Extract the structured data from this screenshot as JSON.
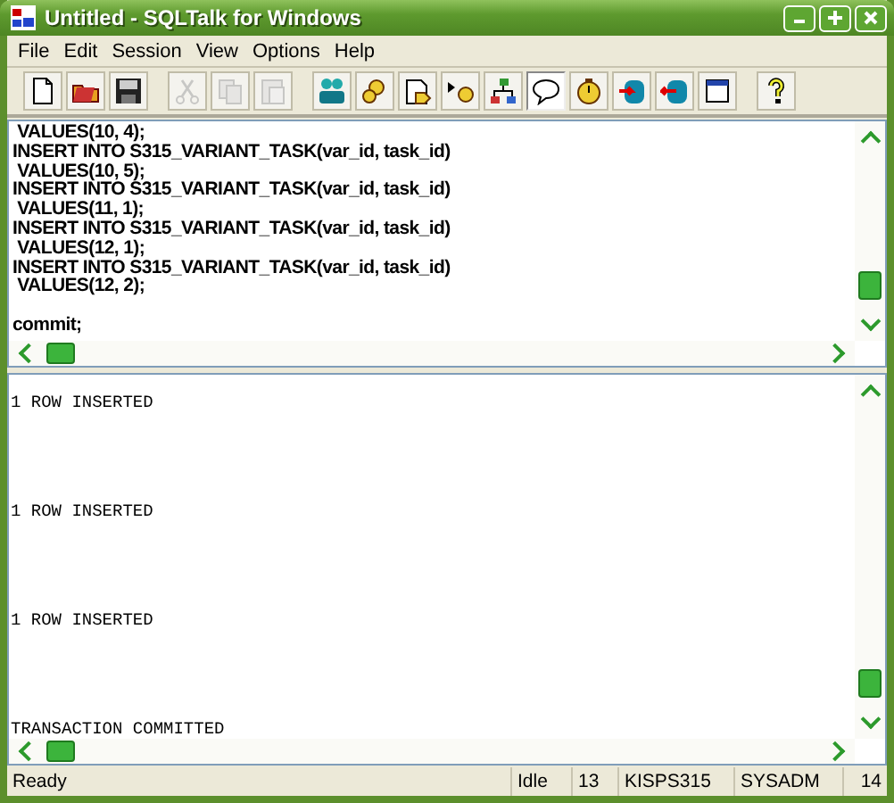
{
  "window": {
    "title": "Untitled - SQLTalk for Windows"
  },
  "menu": [
    {
      "label": "File"
    },
    {
      "label": "Edit"
    },
    {
      "label": "Session"
    },
    {
      "label": "View"
    },
    {
      "label": "Options"
    },
    {
      "label": "Help"
    }
  ],
  "toolbar": [
    {
      "buttons": [
        {
          "kind": "new",
          "disabled": false,
          "pressed": false
        },
        {
          "kind": "open",
          "disabled": false,
          "pressed": false
        },
        {
          "kind": "save",
          "disabled": false,
          "pressed": false
        }
      ]
    },
    {
      "buttons": [
        {
          "kind": "cut",
          "disabled": true,
          "pressed": false
        },
        {
          "kind": "copy",
          "disabled": true,
          "pressed": false
        },
        {
          "kind": "paste",
          "disabled": true,
          "pressed": false
        }
      ]
    },
    {
      "buttons": [
        {
          "kind": "connect",
          "disabled": false,
          "pressed": false
        },
        {
          "kind": "execute",
          "disabled": false,
          "pressed": false
        },
        {
          "kind": "script",
          "disabled": false,
          "pressed": false
        },
        {
          "kind": "step",
          "disabled": false,
          "pressed": false
        },
        {
          "kind": "tree",
          "disabled": false,
          "pressed": false
        },
        {
          "kind": "bubble",
          "disabled": false,
          "pressed": true
        },
        {
          "kind": "timer",
          "disabled": false,
          "pressed": false
        },
        {
          "kind": "db-in",
          "disabled": false,
          "pressed": false
        },
        {
          "kind": "db-out",
          "disabled": false,
          "pressed": false
        },
        {
          "kind": "window",
          "disabled": false,
          "pressed": false
        }
      ]
    },
    {
      "buttons": [
        {
          "kind": "help",
          "disabled": false,
          "pressed": false
        }
      ]
    }
  ],
  "editor": {
    "text": " VALUES(10, 4);\nINSERT INTO S315_VARIANT_TASK(var_id, task_id)\n VALUES(10, 5);\nINSERT INTO S315_VARIANT_TASK(var_id, task_id)\n VALUES(11, 1);\nINSERT INTO S315_VARIANT_TASK(var_id, task_id)\n VALUES(12, 1);\nINSERT INTO S315_VARIANT_TASK(var_id, task_id)\n VALUES(12, 2);\n\ncommit;"
  },
  "output": {
    "messages": [
      "1 ROW INSERTED",
      "1 ROW INSERTED",
      "1 ROW INSERTED",
      "TRANSACTION COMMITTED"
    ]
  },
  "status_bar": {
    "message": "Ready",
    "state": "Idle",
    "field_1": "13",
    "database": "KISPS315",
    "user": "SYSADM",
    "field_2": "14"
  }
}
